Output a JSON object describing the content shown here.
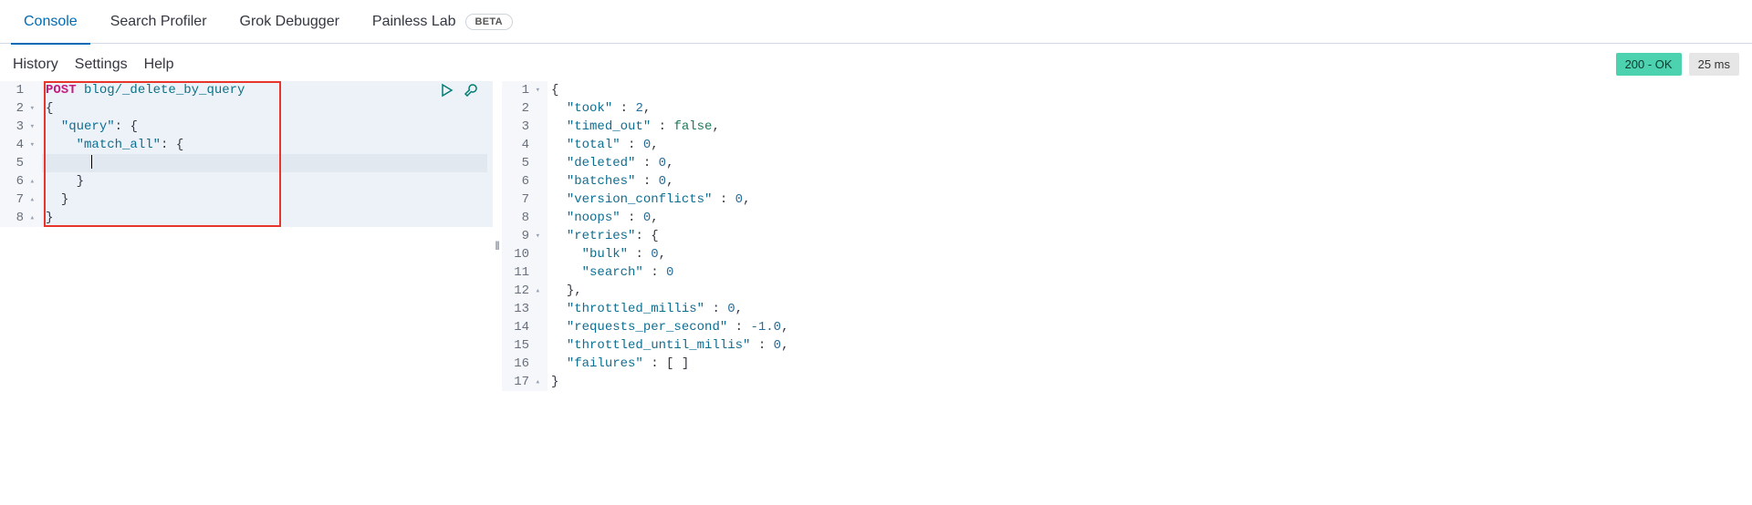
{
  "tabs": [
    {
      "label": "Console",
      "active": true
    },
    {
      "label": "Search Profiler",
      "active": false
    },
    {
      "label": "Grok Debugger",
      "active": false
    },
    {
      "label": "Painless Lab",
      "active": false,
      "badge": "BETA"
    }
  ],
  "subnav": {
    "history": "History",
    "settings": "Settings",
    "help": "Help"
  },
  "status": {
    "ok_label": "200 - OK",
    "duration": "25 ms"
  },
  "request": {
    "highlight_box": true,
    "lines": [
      {
        "n": "1",
        "fold": "",
        "type": "req",
        "method": "POST",
        "path": "blog/_delete_by_query"
      },
      {
        "n": "2",
        "fold": "▾",
        "type": "brace",
        "indent": 0,
        "open": true
      },
      {
        "n": "3",
        "fold": "▾",
        "type": "keyobj",
        "indent": 1,
        "key": "query"
      },
      {
        "n": "4",
        "fold": "▾",
        "type": "keyobj",
        "indent": 2,
        "key": "match_all"
      },
      {
        "n": "5",
        "fold": "",
        "type": "cursor",
        "indent": 3,
        "active": true
      },
      {
        "n": "6",
        "fold": "▴",
        "type": "brace",
        "indent": 2,
        "open": false
      },
      {
        "n": "7",
        "fold": "▴",
        "type": "brace",
        "indent": 1,
        "open": false
      },
      {
        "n": "8",
        "fold": "▴",
        "type": "brace",
        "indent": 0,
        "open": false
      }
    ]
  },
  "response": {
    "lines": [
      {
        "n": "1",
        "fold": "▾",
        "type": "brace",
        "indent": 0,
        "open": true
      },
      {
        "n": "2",
        "fold": "",
        "type": "kv",
        "indent": 1,
        "key": "took",
        "val": "2",
        "vtype": "num",
        "comma": true
      },
      {
        "n": "3",
        "fold": "",
        "type": "kv",
        "indent": 1,
        "key": "timed_out",
        "val": "false",
        "vtype": "bool",
        "comma": true
      },
      {
        "n": "4",
        "fold": "",
        "type": "kv",
        "indent": 1,
        "key": "total",
        "val": "0",
        "vtype": "num",
        "comma": true
      },
      {
        "n": "5",
        "fold": "",
        "type": "kv",
        "indent": 1,
        "key": "deleted",
        "val": "0",
        "vtype": "num",
        "comma": true
      },
      {
        "n": "6",
        "fold": "",
        "type": "kv",
        "indent": 1,
        "key": "batches",
        "val": "0",
        "vtype": "num",
        "comma": true
      },
      {
        "n": "7",
        "fold": "",
        "type": "kv",
        "indent": 1,
        "key": "version_conflicts",
        "val": "0",
        "vtype": "num",
        "comma": true
      },
      {
        "n": "8",
        "fold": "",
        "type": "kv",
        "indent": 1,
        "key": "noops",
        "val": "0",
        "vtype": "num",
        "comma": true
      },
      {
        "n": "9",
        "fold": "▾",
        "type": "keyobj",
        "indent": 1,
        "key": "retries"
      },
      {
        "n": "10",
        "fold": "",
        "type": "kv",
        "indent": 2,
        "key": "bulk",
        "val": "0",
        "vtype": "num",
        "comma": true
      },
      {
        "n": "11",
        "fold": "",
        "type": "kv",
        "indent": 2,
        "key": "search",
        "val": "0",
        "vtype": "num",
        "comma": false
      },
      {
        "n": "12",
        "fold": "▴",
        "type": "close",
        "indent": 1,
        "comma": true
      },
      {
        "n": "13",
        "fold": "",
        "type": "kv",
        "indent": 1,
        "key": "throttled_millis",
        "val": "0",
        "vtype": "num",
        "comma": true
      },
      {
        "n": "14",
        "fold": "",
        "type": "kv",
        "indent": 1,
        "key": "requests_per_second",
        "val": "-1.0",
        "vtype": "num",
        "comma": true
      },
      {
        "n": "15",
        "fold": "",
        "type": "kv",
        "indent": 1,
        "key": "throttled_until_millis",
        "val": "0",
        "vtype": "num",
        "comma": true
      },
      {
        "n": "16",
        "fold": "",
        "type": "kv",
        "indent": 1,
        "key": "failures",
        "val": "[ ]",
        "vtype": "raw",
        "comma": false
      },
      {
        "n": "17",
        "fold": "▴",
        "type": "brace",
        "indent": 0,
        "open": false
      }
    ]
  }
}
